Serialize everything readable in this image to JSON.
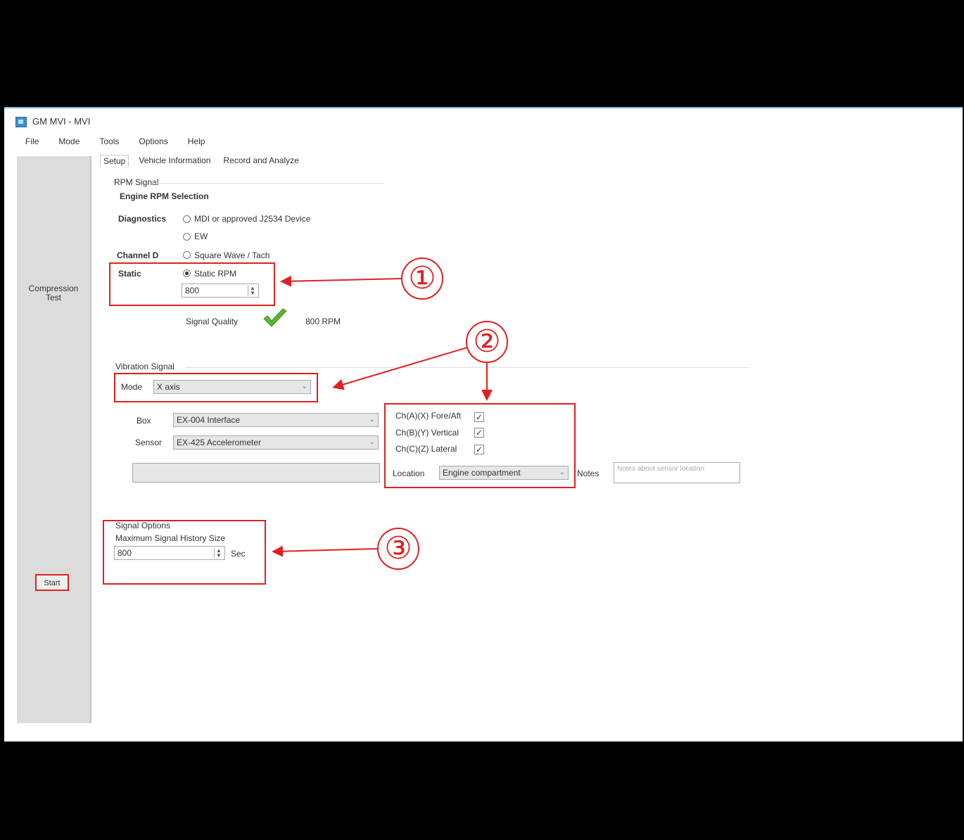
{
  "window": {
    "title": "GM MVI - MVI"
  },
  "menu": [
    "File",
    "Mode",
    "Tools",
    "Options",
    "Help"
  ],
  "tabs": [
    "Setup",
    "Vehicle Information",
    "Record and Analyze"
  ],
  "sidebar": {
    "compression_test": "Compression Test",
    "start": "Start"
  },
  "rpm_signal": {
    "group_label": "RPM Signal",
    "heading": "Engine RPM Selection",
    "diagnostics_label": "Diagnostics",
    "option_mdi": "MDI or approved J2534 Device",
    "option_ew": "EW",
    "channel_label": "Channel D",
    "option_square": "Square Wave / Tach",
    "static_label": "Static",
    "option_static": "Static RPM",
    "static_value": "800",
    "signal_quality_label": "Signal Quality",
    "signal_quality_value": "800 RPM"
  },
  "vibration_signal": {
    "group_label": "Vibration Signal",
    "mode_label": "Mode",
    "mode_value": "X axis",
    "box_label": "Box",
    "box_value": "EX-004 Interface",
    "sensor_label": "Sensor",
    "sensor_value": "EX-425 Accelerometer",
    "axis_options": [
      {
        "label": "Ch(A)(X) Fore/Aft",
        "checked": true
      },
      {
        "label": "Ch(B)(Y) Vertical",
        "checked": true
      },
      {
        "label": "Ch(C)(Z) Lateral",
        "checked": true
      }
    ],
    "location_label": "Location",
    "location_value": "Engine compartment",
    "notes_label": "Notes",
    "notes_placeholder": "Notes about sensor location"
  },
  "signal_options": {
    "group_label": "Signal Options",
    "history_label": "Maximum Signal History Size",
    "history_value": "800",
    "history_unit": "Sec"
  },
  "annotations": [
    "①",
    "②",
    "③"
  ],
  "colors": {
    "annotation": "#e02020",
    "check": "#5cb82e",
    "sidebar": "#dcdcdc"
  }
}
